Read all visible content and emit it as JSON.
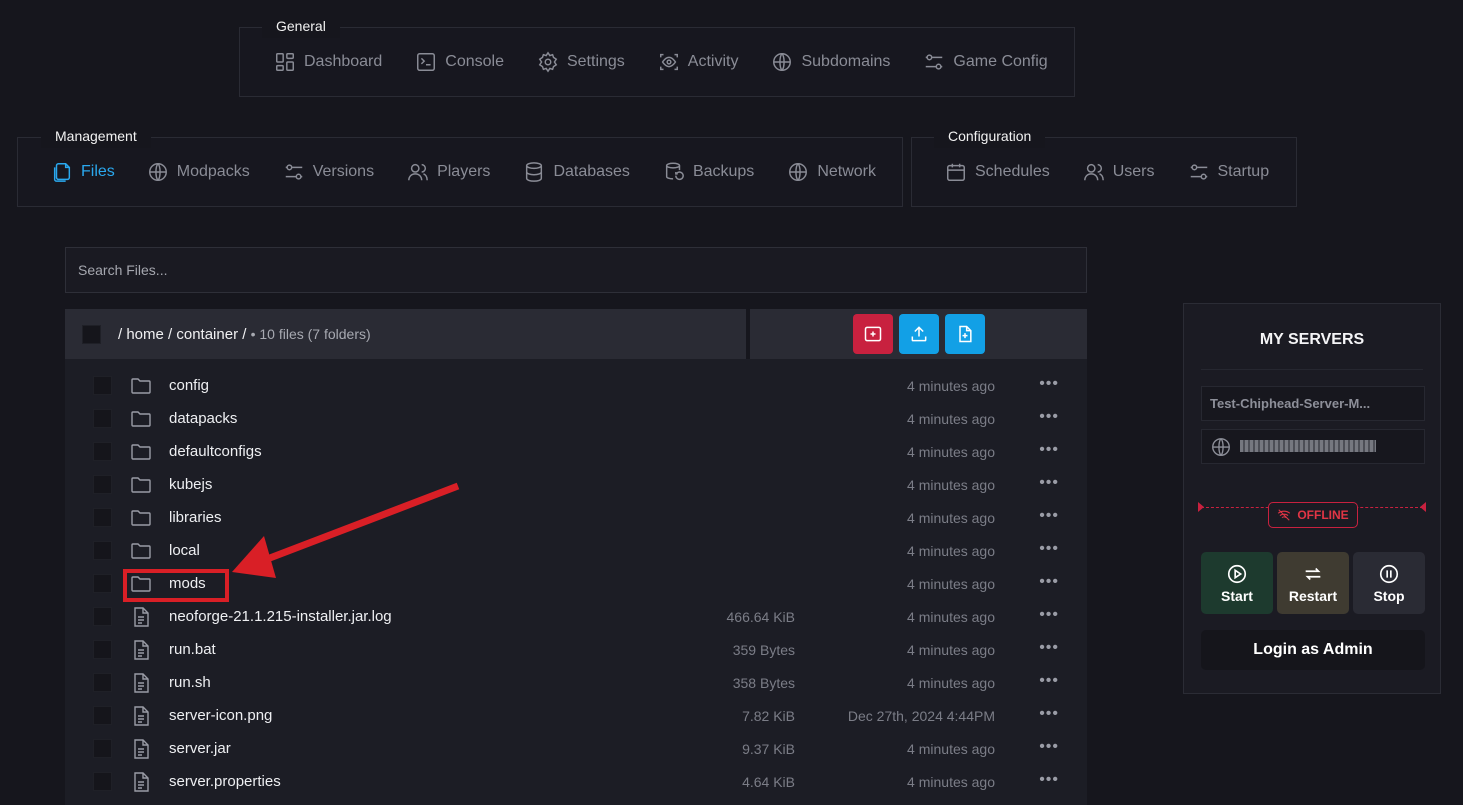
{
  "nav": {
    "general": {
      "legend": "General",
      "tabs": [
        "Dashboard",
        "Console",
        "Settings",
        "Activity",
        "Subdomains",
        "Game Config"
      ]
    },
    "management": {
      "legend": "Management",
      "tabs": [
        "Files",
        "Modpacks",
        "Versions",
        "Players",
        "Databases",
        "Backups",
        "Network"
      ],
      "active": "Files"
    },
    "configuration": {
      "legend": "Configuration",
      "tabs": [
        "Schedules",
        "Users",
        "Startup"
      ]
    }
  },
  "search": {
    "placeholder": "Search Files..."
  },
  "files": {
    "path": "/ home / container /",
    "summary": "• 10 files (7 folders)",
    "rows": [
      {
        "name": "config",
        "type": "folder",
        "size": "",
        "modified": "4 minutes ago"
      },
      {
        "name": "datapacks",
        "type": "folder",
        "size": "",
        "modified": "4 minutes ago"
      },
      {
        "name": "defaultconfigs",
        "type": "folder",
        "size": "",
        "modified": "4 minutes ago"
      },
      {
        "name": "kubejs",
        "type": "folder",
        "size": "",
        "modified": "4 minutes ago"
      },
      {
        "name": "libraries",
        "type": "folder",
        "size": "",
        "modified": "4 minutes ago"
      },
      {
        "name": "local",
        "type": "folder",
        "size": "",
        "modified": "4 minutes ago"
      },
      {
        "name": "mods",
        "type": "folder",
        "size": "",
        "modified": "4 minutes ago"
      },
      {
        "name": "neoforge-21.1.215-installer.jar.log",
        "type": "file",
        "size": "466.64 KiB",
        "modified": "4 minutes ago"
      },
      {
        "name": "run.bat",
        "type": "file",
        "size": "359 Bytes",
        "modified": "4 minutes ago"
      },
      {
        "name": "run.sh",
        "type": "file",
        "size": "358 Bytes",
        "modified": "4 minutes ago"
      },
      {
        "name": "server-icon.png",
        "type": "file",
        "size": "7.82 KiB",
        "modified": "Dec 27th, 2024 4:44PM"
      },
      {
        "name": "server.jar",
        "type": "file",
        "size": "9.37 KiB",
        "modified": "4 minutes ago"
      },
      {
        "name": "server.properties",
        "type": "file",
        "size": "4.64 KiB",
        "modified": "4 minutes ago"
      }
    ],
    "more_label": "•••"
  },
  "servers": {
    "title": "MY SERVERS",
    "server_name": "Test-Chiphead-Server-M...",
    "status": "OFFLINE",
    "buttons": {
      "start": "Start",
      "restart": "Restart",
      "stop": "Stop"
    },
    "login": "Login as Admin"
  },
  "colors": {
    "accent": "#2aa8ee",
    "danger": "#c8213f",
    "annotation": "#d91f26"
  }
}
